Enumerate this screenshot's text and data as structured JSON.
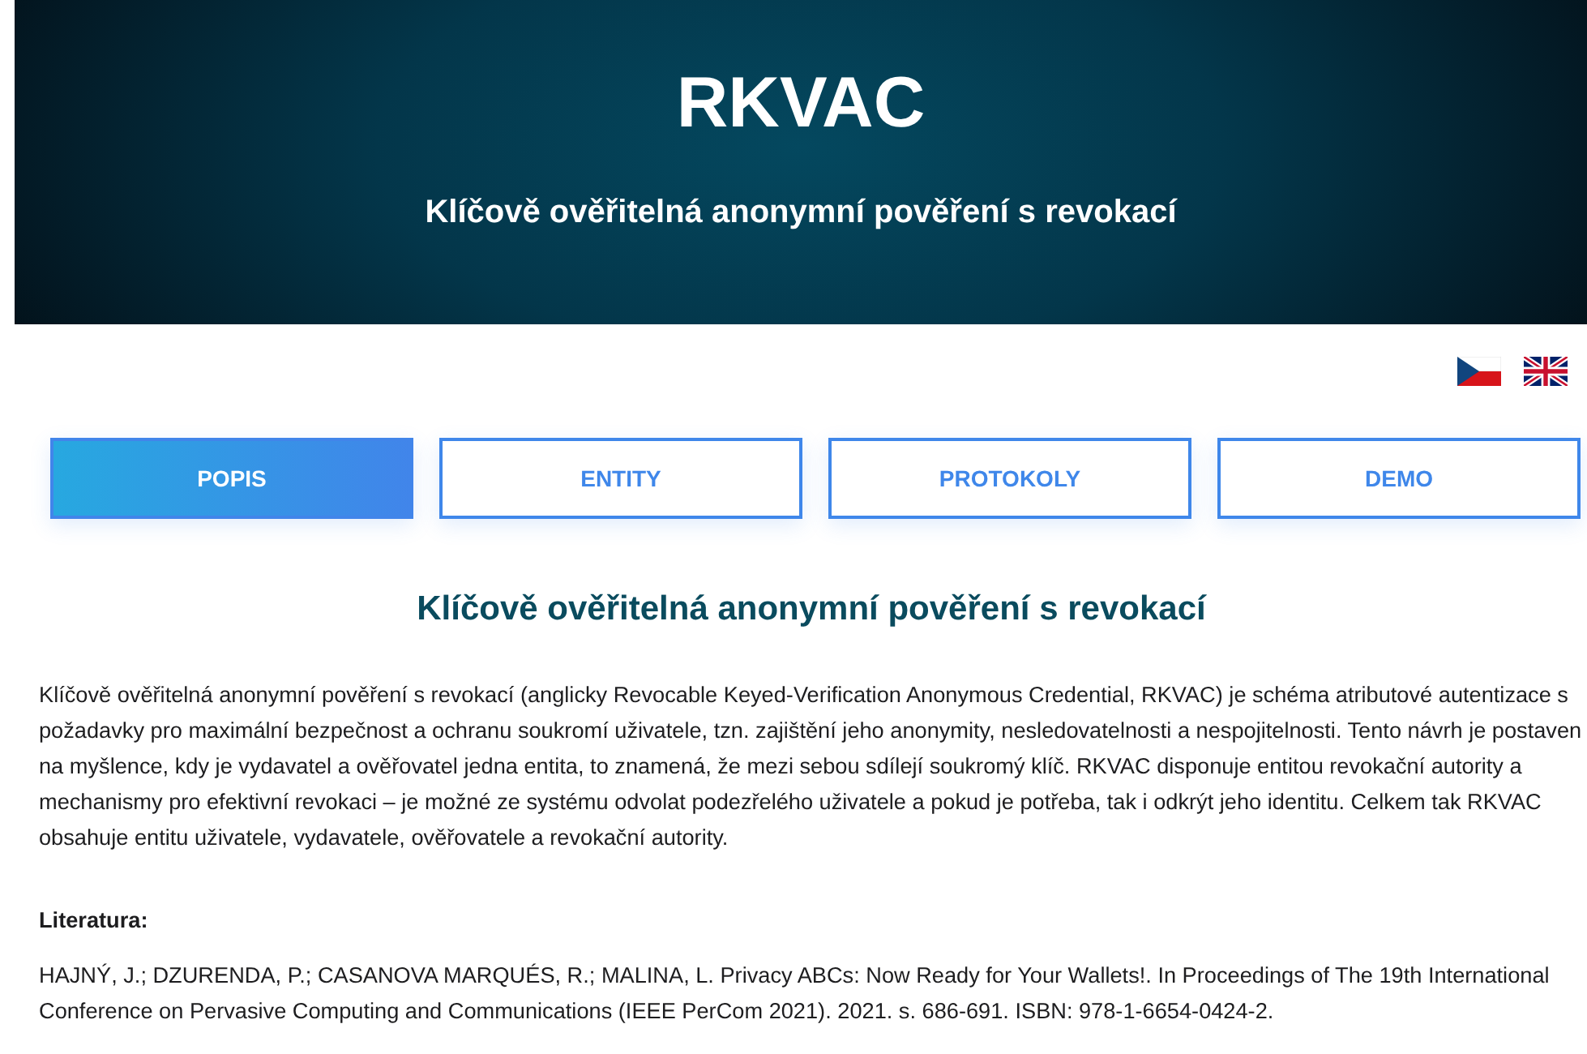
{
  "header": {
    "title": "RKVAC",
    "subtitle": "Klíčově ověřitelná anonymní pověření s revokací"
  },
  "languages": [
    {
      "kind": "czech"
    },
    {
      "kind": "english"
    }
  ],
  "tabs": [
    {
      "label": "POPIS",
      "selected": true
    },
    {
      "label": "ENTITY",
      "selected": false
    },
    {
      "label": "PROTOKOLY",
      "selected": false
    },
    {
      "label": "DEMO",
      "selected": false
    }
  ],
  "content": {
    "heading": "Klíčově ověřitelná anonymní pověření s revokací",
    "paragraph": "Klíčově ověřitelná anonymní pověření s revokací (anglicky Revocable Keyed-Verification Anonymous Credential, RKVAC) je schéma atributové autentizace s požadavky pro maximální bezpečnost a ochranu soukromí uživatele, tzn. zajištění jeho anonymity, nesledovatelnosti a nespojitelnosti. Tento návrh je postaven na myšlence, kdy je vydavatel a ověřovatel jedna entita, to znamená, že mezi sebou sdílejí soukromý klíč. RKVAC disponuje entitou revokační autority a mechanismy pro efektivní revokaci – je možné ze systému odvolat podezřelého uživatele a pokud je potřeba, tak i odkrýt jeho identitu. Celkem tak RKVAC obsahuje entitu uživatele, vydavatele, ověřovatele a revokační autority.",
    "literature_label": "Literatura:",
    "references": [
      "HAJNÝ, J.; DZURENDA, P.; CASANOVA MARQUÉS, R.; MALINA, L. Privacy ABCs: Now Ready for Your Wallets!. In Proceedings of The 19th International Conference on Pervasive Computing and Communications (IEEE PerCom 2021). 2021. s. 686-691. ISBN: 978-1-6654-0424-2."
    ]
  }
}
